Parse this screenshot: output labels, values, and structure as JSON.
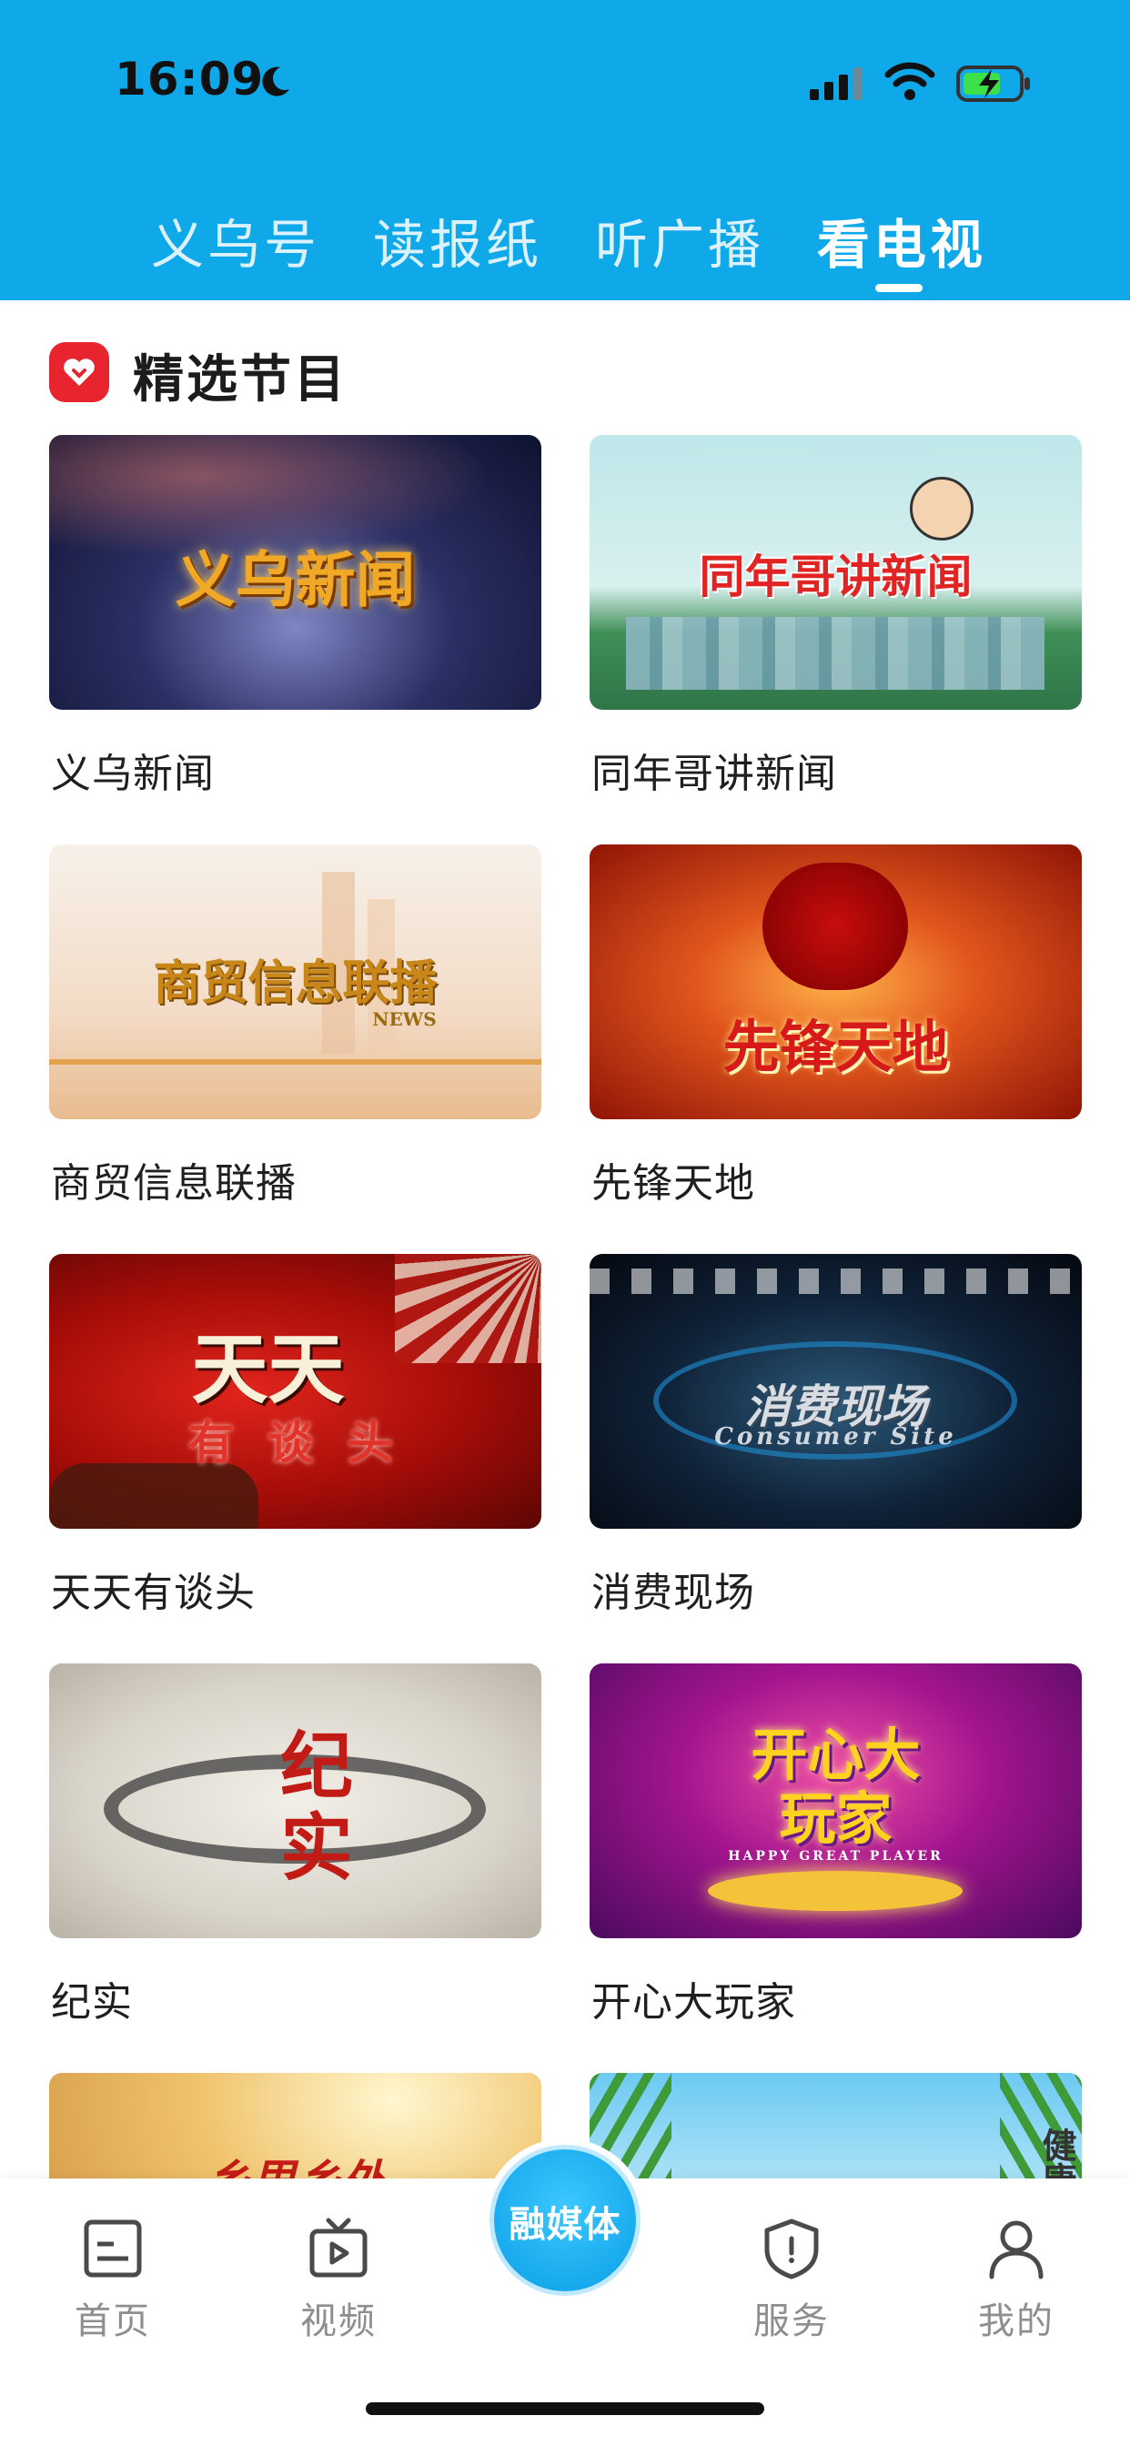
{
  "status_bar": {
    "time": "16:09"
  },
  "tabs": [
    {
      "label": "义乌号",
      "active": false
    },
    {
      "label": "读报纸",
      "active": false
    },
    {
      "label": "听广播",
      "active": false
    },
    {
      "label": "看电视",
      "active": true
    }
  ],
  "section": {
    "title": "精选节目"
  },
  "programs": [
    {
      "label": "义乌新闻",
      "thumb_text": "义乌新闻"
    },
    {
      "label": "同年哥讲新闻",
      "thumb_text": "同年哥讲新闻"
    },
    {
      "label": "商贸信息联播",
      "thumb_text": "商贸信息联播",
      "thumb_subtext": "NEWS"
    },
    {
      "label": "先锋天地",
      "thumb_text": "先锋天地"
    },
    {
      "label": "天天有谈头",
      "thumb_text": "天天",
      "thumb_subtext": "有 谈 头"
    },
    {
      "label": "消费现场",
      "thumb_text": "消费现场",
      "thumb_subtext": "Consumer Site"
    },
    {
      "label": "纪实",
      "thumb_text": "纪实"
    },
    {
      "label": "开心大玩家",
      "thumb_text": "开心大玩家",
      "thumb_subtext": "HAPPY GREAT PLAYER"
    },
    {
      "thumb_text": "乡里乡外"
    },
    {
      "thumb_text": "健康"
    }
  ],
  "bottom_nav": {
    "items": [
      {
        "label": "首页",
        "icon": "news-icon"
      },
      {
        "label": "视频",
        "icon": "tv-icon"
      },
      {
        "label": "服务",
        "icon": "shield-icon"
      },
      {
        "label": "我的",
        "icon": "user-icon"
      }
    ],
    "center": {
      "label": "融媒体"
    }
  },
  "colors": {
    "header": "#0fa9ea",
    "accent_red": "#e8242f"
  }
}
